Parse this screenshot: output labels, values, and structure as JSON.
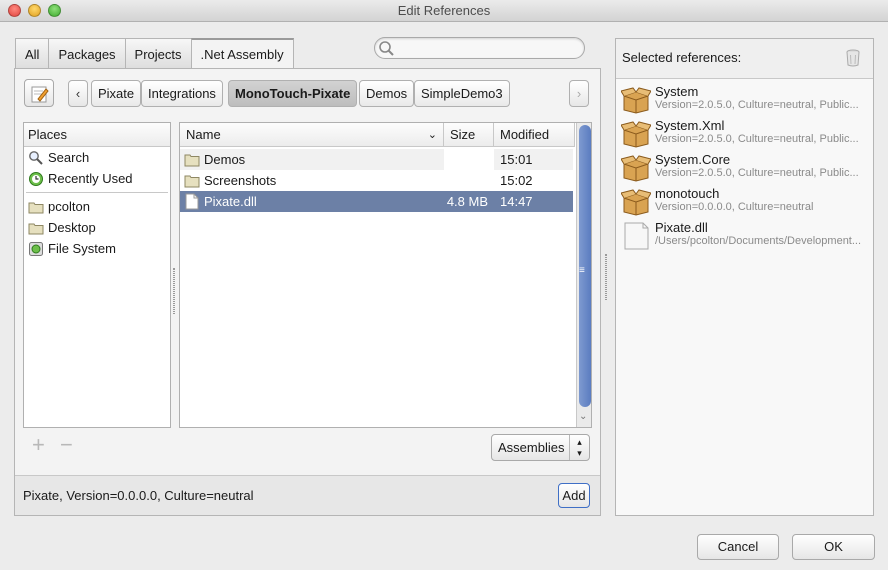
{
  "window": {
    "title": "Edit References"
  },
  "tabs": [
    "All",
    "Packages",
    "Projects",
    ".Net Assembly"
  ],
  "search": {
    "placeholder": ""
  },
  "breadcrumb": {
    "items": [
      "Pixate",
      "Integrations",
      "MonoTouch-Pixate",
      "Demos",
      "SimpleDemo3"
    ],
    "active": "MonoTouch-Pixate"
  },
  "places": {
    "header": "Places",
    "items": [
      {
        "label": "Search",
        "icon": "search-icon"
      },
      {
        "label": "Recently Used",
        "icon": "recent-icon"
      },
      {
        "label": "pcolton",
        "icon": "folder-icon"
      },
      {
        "label": "Desktop",
        "icon": "folder-icon"
      },
      {
        "label": "File System",
        "icon": "filesystem-icon"
      }
    ]
  },
  "files": {
    "columns": {
      "name": "Name",
      "size": "Size",
      "modified": "Modified"
    },
    "rows": [
      {
        "name": "Demos",
        "size": "",
        "modified": "15:01",
        "icon": "folder-icon"
      },
      {
        "name": "Screenshots",
        "size": "",
        "modified": "15:02",
        "icon": "folder-icon"
      },
      {
        "name": "Pixate.dll",
        "size": "4.8 MB",
        "modified": "14:47",
        "icon": "file-icon",
        "selected": true
      }
    ]
  },
  "filter": {
    "selected": "Assemblies"
  },
  "status": {
    "text": "Pixate, Version=0.0.0.0, Culture=neutral",
    "add_label": "Add"
  },
  "references": {
    "header": "Selected references:",
    "items": [
      {
        "name": "System",
        "detail": "Version=2.0.5.0, Culture=neutral, Public...",
        "icon": "package-icon"
      },
      {
        "name": "System.Xml",
        "detail": "Version=2.0.5.0, Culture=neutral, Public...",
        "icon": "package-icon"
      },
      {
        "name": "System.Core",
        "detail": "Version=2.0.5.0, Culture=neutral, Public...",
        "icon": "package-icon"
      },
      {
        "name": "monotouch",
        "detail": "Version=0.0.0.0, Culture=neutral",
        "icon": "package-icon"
      },
      {
        "name": "Pixate.dll",
        "detail": "/Users/pcolton/Documents/Development...",
        "icon": "file-icon"
      }
    ]
  },
  "buttons": {
    "cancel": "Cancel",
    "ok": "OK"
  },
  "colors": {
    "selection": "#6c80a6",
    "scroll_thumb": "#5b7cc0",
    "default_button_border": "#3f6fc6"
  }
}
